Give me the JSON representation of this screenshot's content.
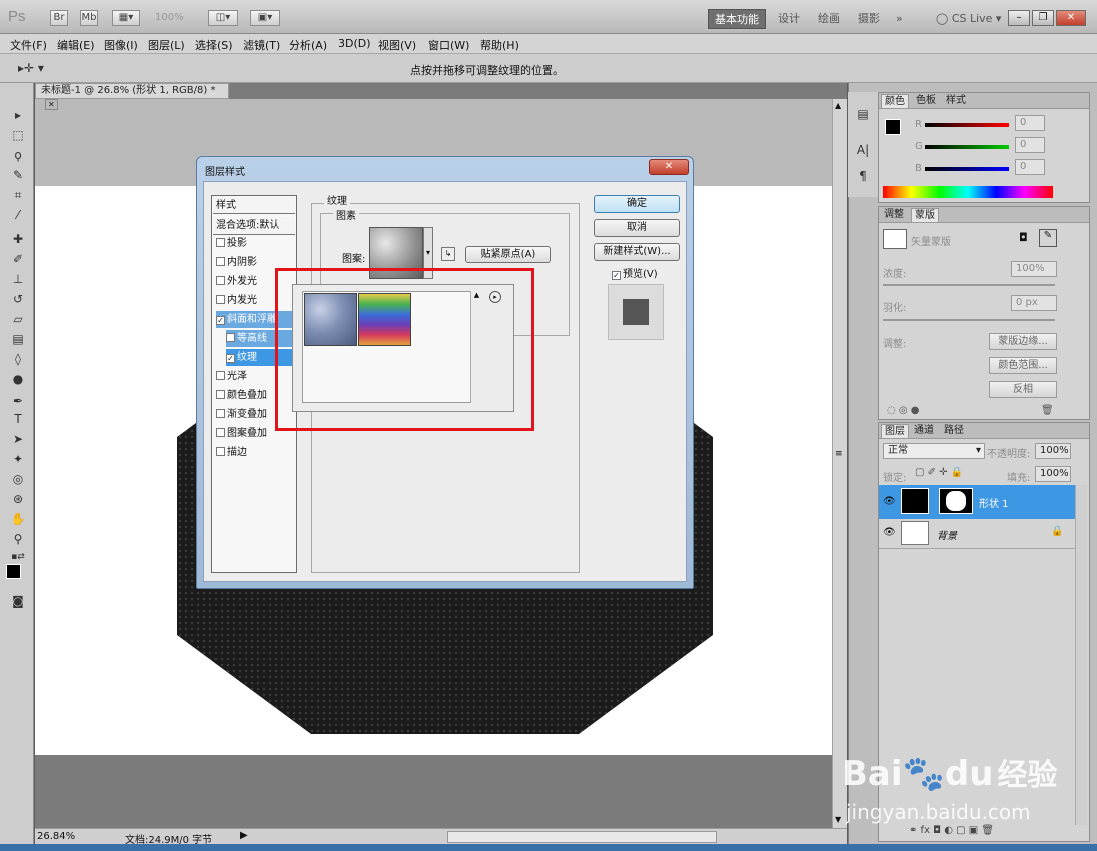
{
  "app": {
    "logo": "Ps",
    "zoom_selector": "100%",
    "workspaces": [
      "基本功能",
      "设计",
      "绘画",
      "摄影"
    ],
    "more": "»",
    "cs_live": "CS Live"
  },
  "menu": [
    "文件(F)",
    "编辑(E)",
    "图像(I)",
    "图层(L)",
    "选择(S)",
    "滤镜(T)",
    "分析(A)",
    "3D(D)",
    "视图(V)",
    "窗口(W)",
    "帮助(H)"
  ],
  "options_bar": {
    "hint": "点按并拖移可调整纹理的位置。"
  },
  "document": {
    "tab_title": "未标题-1 @ 26.8% (形状 1, RGB/8) *",
    "zoom": "26.84%",
    "doc_info": "文档:24.9M/0 字节"
  },
  "dialog": {
    "title": "图层样式",
    "styles_header": "样式",
    "blend_options": "混合选项:默认",
    "styles": [
      {
        "label": "投影",
        "checked": false
      },
      {
        "label": "内阴影",
        "checked": false
      },
      {
        "label": "外发光",
        "checked": false
      },
      {
        "label": "内发光",
        "checked": false
      },
      {
        "label": "斜面和浮雕",
        "checked": true
      },
      {
        "label": "等高线",
        "checked": false
      },
      {
        "label": "纹理",
        "checked": true
      },
      {
        "label": "光泽",
        "checked": false
      },
      {
        "label": "颜色叠加",
        "checked": false
      },
      {
        "label": "渐变叠加",
        "checked": false
      },
      {
        "label": "图案叠加",
        "checked": false
      },
      {
        "label": "描边",
        "checked": false
      }
    ],
    "section_title": "纹理",
    "group_title": "图素",
    "pattern_label": "图案:",
    "snap_origin": "贴紧原点(A)",
    "ok": "确定",
    "cancel": "取消",
    "new_style": "新建样式(W)...",
    "preview": "预览(V)",
    "preview_checked": true
  },
  "color_panel": {
    "tabs": [
      "颜色",
      "色板",
      "样式"
    ],
    "channels": [
      {
        "name": "R",
        "value": "0"
      },
      {
        "name": "G",
        "value": "0"
      },
      {
        "name": "B",
        "value": "0"
      }
    ]
  },
  "adjust_panel": {
    "tabs": [
      "调整",
      "蒙版"
    ],
    "mask_label": "矢量蒙版",
    "density_label": "浓度:",
    "density_value": "100%",
    "feather_label": "羽化:",
    "feather_value": "0 px",
    "refine_label": "调整:",
    "mask_edge": "蒙版边缘...",
    "color_range": "颜色范围...",
    "invert": "反相"
  },
  "layers_panel": {
    "tabs": [
      "图层",
      "通道",
      "路径"
    ],
    "blend_mode": "正常",
    "opacity_label": "不透明度:",
    "opacity_value": "100%",
    "lock_label": "锁定:",
    "fill_label": "填充:",
    "fill_value": "100%",
    "layers": [
      {
        "name": "形状 1",
        "selected": true
      },
      {
        "name": "背景",
        "selected": false
      }
    ]
  },
  "watermark": {
    "brand": "Bai",
    "brand2": "du",
    "cn": "经验",
    "url": "jingyan.baidu.com"
  }
}
